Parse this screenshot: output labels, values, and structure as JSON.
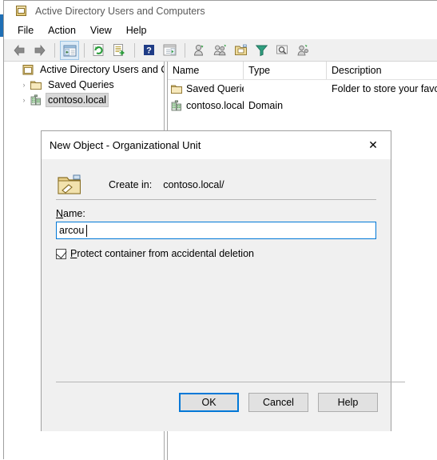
{
  "window": {
    "title": "Active Directory Users and Computers",
    "app_icon": "console-window-icon"
  },
  "menu": {
    "items": [
      {
        "label": "File",
        "name": "menu-file"
      },
      {
        "label": "Action",
        "name": "menu-action"
      },
      {
        "label": "View",
        "name": "menu-view"
      },
      {
        "label": "Help",
        "name": "menu-help"
      }
    ]
  },
  "toolbar": {
    "buttons": [
      {
        "name": "back-icon",
        "tooltip": "Back"
      },
      {
        "name": "forward-icon",
        "tooltip": "Forward"
      },
      {
        "name": "show-hide-console-tree-icon",
        "tooltip": "Show/Hide Console Tree"
      },
      {
        "name": "refresh-icon",
        "tooltip": "Refresh"
      },
      {
        "name": "export-list-icon",
        "tooltip": "Export List"
      },
      {
        "name": "help-icon",
        "tooltip": "Help"
      },
      {
        "name": "show-hide-action-pane-icon",
        "tooltip": "Show/Hide Action Pane"
      },
      {
        "name": "new-user-icon",
        "tooltip": "New User"
      },
      {
        "name": "new-group-icon",
        "tooltip": "New Group"
      },
      {
        "name": "new-ou-icon",
        "tooltip": "New Organizational Unit"
      },
      {
        "name": "filter-icon",
        "tooltip": "Filter"
      },
      {
        "name": "find-icon",
        "tooltip": "Find"
      },
      {
        "name": "new-contact-icon",
        "tooltip": "New Contact"
      }
    ]
  },
  "tree": {
    "nodes": [
      {
        "label": "Active Directory Users and Com",
        "icon": "console-root-icon",
        "expander": "",
        "selected": false
      },
      {
        "label": "Saved Queries",
        "icon": "folder-icon",
        "expander": "›",
        "selected": false
      },
      {
        "label": "contoso.local",
        "icon": "domain-icon",
        "expander": "›",
        "selected": true
      }
    ]
  },
  "list": {
    "columns": [
      {
        "label": "Name",
        "name": "column-header-name"
      },
      {
        "label": "Type",
        "name": "column-header-type"
      },
      {
        "label": "Description",
        "name": "column-header-description"
      }
    ],
    "rows": [
      {
        "name": "Saved Queries",
        "icon": "folder-icon",
        "type": "",
        "description": "Folder to store your favo..."
      },
      {
        "name": "contoso.local",
        "icon": "domain-icon",
        "type": "Domain",
        "description": ""
      }
    ]
  },
  "dialog": {
    "title": "New Object - Organizational Unit",
    "close_label": "✕",
    "icon": "organizational-unit-icon",
    "create_in_label": "Create in:",
    "create_in_value": "contoso.local/",
    "name_label_prefix": "N",
    "name_label_suffix": "ame:",
    "name_value": "arcou",
    "name_placeholder": "",
    "protect_label_prefix": "P",
    "protect_label_suffix": "rotect container from accidental deletion",
    "protect_checked": true,
    "buttons": [
      {
        "label": "OK",
        "name": "ok-button",
        "default": true
      },
      {
        "label": "Cancel",
        "name": "cancel-button",
        "default": false
      },
      {
        "label": "Help",
        "name": "help-button",
        "default": false
      }
    ]
  },
  "colors": {
    "accent": "#0078d7",
    "dialog_bg": "#f0f0f0",
    "toolbar_bg": "#f0f0f0",
    "selection": "#d8d8d8"
  }
}
